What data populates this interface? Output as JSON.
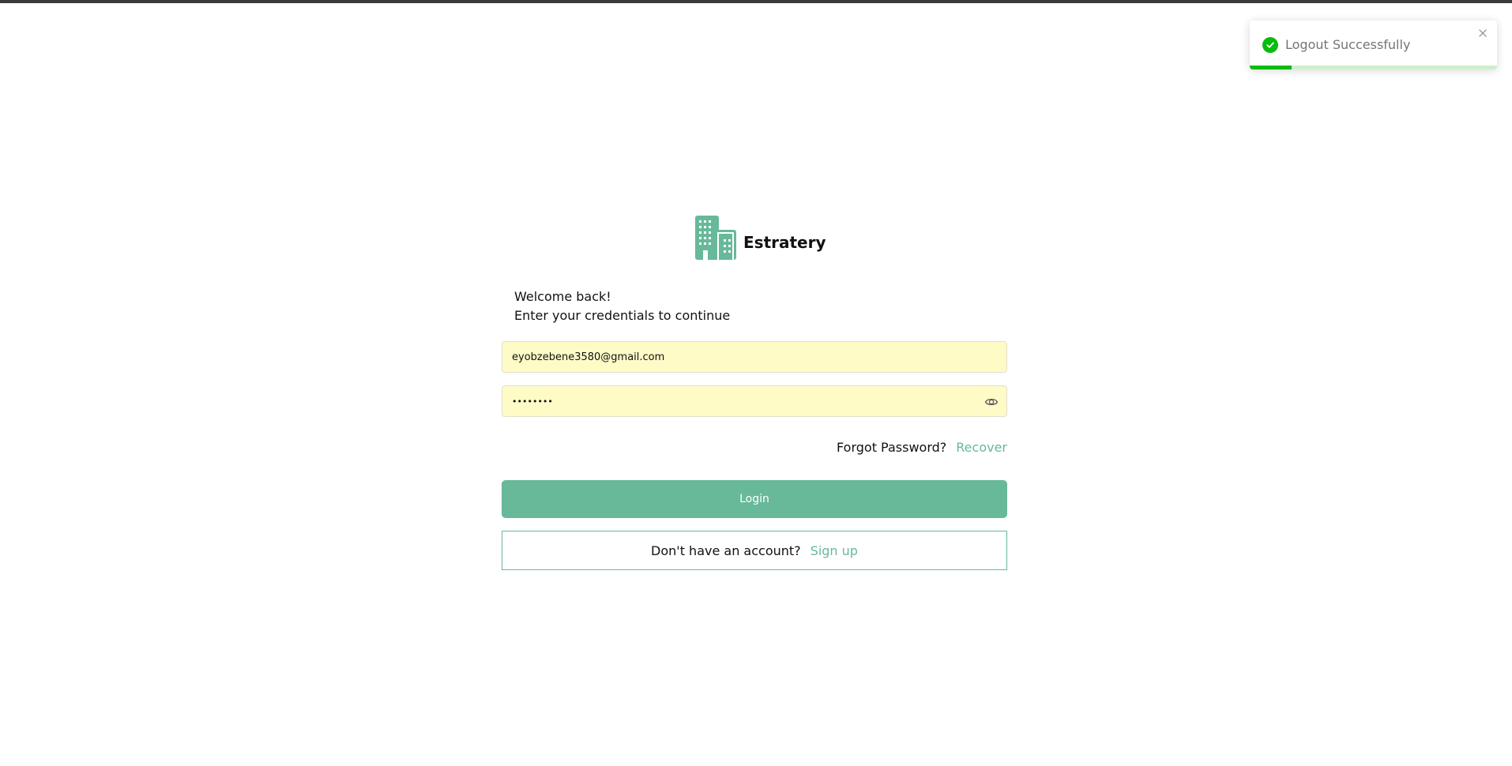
{
  "toast": {
    "message": "Logout Successfully",
    "progress": 0.17,
    "icon": "check-circle-icon",
    "close_icon": "close-icon",
    "success_color": "#07bc0c"
  },
  "brand": {
    "name": "Estratery",
    "logo_icon": "buildings-icon",
    "accent_color": "#67b99a"
  },
  "welcome": {
    "line1": "Welcome back!",
    "line2": "Enter your credentials to continue"
  },
  "form": {
    "email_value": "eyobzebene3580@gmail.com",
    "password_value": "••••••••",
    "password_toggle_icon": "eye-icon",
    "forgot_label": "Forgot Password?",
    "recover_link": "Recover",
    "login_label": "Login",
    "autofill_color": "#fefbc7"
  },
  "signup": {
    "prompt": "Don't have an account?",
    "link": "Sign up"
  }
}
